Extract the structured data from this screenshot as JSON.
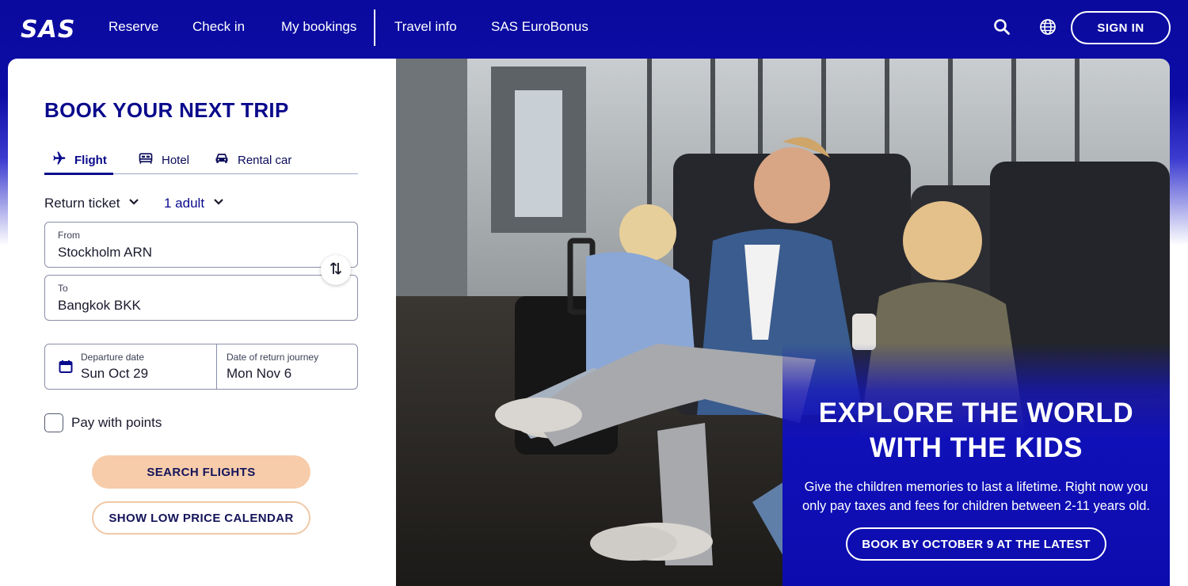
{
  "header": {
    "logo": "SAS",
    "nav": [
      "Reserve",
      "Check in",
      "My bookings",
      "Travel info",
      "SAS EuroBonus"
    ],
    "search_icon": "search-icon",
    "language_icon": "globe-icon",
    "sign_in": "SIGN IN"
  },
  "booking": {
    "title": "BOOK YOUR NEXT TRIP",
    "tabs": [
      {
        "label": "Flight",
        "icon": "plane-icon",
        "active": true
      },
      {
        "label": "Hotel",
        "icon": "bed-icon",
        "active": false
      },
      {
        "label": "Rental car",
        "icon": "car-icon",
        "active": false
      }
    ],
    "trip_type": "Return ticket",
    "passengers": "1 adult",
    "from": {
      "label": "From",
      "value": "Stockholm ARN"
    },
    "to": {
      "label": "To",
      "value": "Bangkok BKK"
    },
    "departure": {
      "label": "Departure date",
      "value": "Sun Oct 29"
    },
    "return": {
      "label": "Date of return journey",
      "value": "Mon Nov 6"
    },
    "pay_with_points": "Pay with points",
    "search_button": "SEARCH FLIGHTS",
    "calendar_button": "SHOW LOW PRICE CALENDAR"
  },
  "promo": {
    "title_line1": "EXPLORE THE WORLD",
    "title_line2": "WITH THE KIDS",
    "text_line1": "Give the children memories to last a lifetime. Right now you",
    "text_line2": "only pay taxes and fees for children between 2-11 years old.",
    "button": "BOOK BY OCTOBER 9 AT THE LATEST"
  },
  "colors": {
    "brand_blue": "#0a0a9e",
    "title_blue": "#0a0a8c",
    "cta_peach": "#f6ccaa"
  }
}
